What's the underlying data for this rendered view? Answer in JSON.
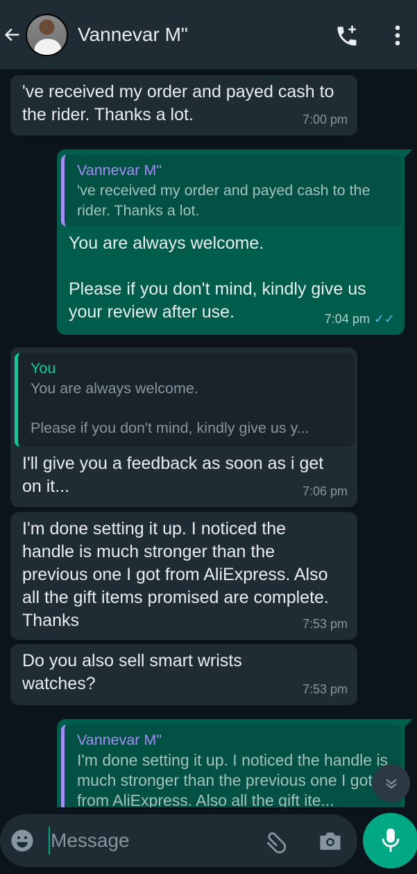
{
  "header": {
    "title": "Vannevar M\"",
    "back_icon": "arrow-left-icon",
    "call_icon": "phone-plus-icon",
    "menu_icon": "more-vertical-icon"
  },
  "messages": [
    {
      "dir": "in",
      "text": "'ve received my order and payed cash to the rider. Thanks a lot.",
      "time": "7:00 pm"
    },
    {
      "dir": "out",
      "quote": {
        "name": "Vannevar M\"",
        "text": "'ve received my order and payed cash to the rider. Thanks a lot."
      },
      "text1": "You are always welcome.",
      "text2": "Please if you don't mind, kindly give us your review after use.",
      "time": "7:04 pm",
      "status": "read"
    },
    {
      "dir": "in",
      "quote": {
        "name": "You",
        "text1": "You are always welcome.",
        "text2": "Please if you don't mind, kindly give us y..."
      },
      "text": "I'll give you a feedback as soon as i get on it...",
      "time": "7:06 pm"
    },
    {
      "dir": "in",
      "text": "I'm done setting it up. I noticed the handle is much stronger than the previous one I got from AliExpress. Also all the gift items promised are complete. Thanks",
      "time": "7:53 pm"
    },
    {
      "dir": "in",
      "text": "Do you also sell smart wrists watches?",
      "time": "7:53 pm"
    },
    {
      "dir": "out",
      "quote": {
        "name": "Vannevar M\"",
        "text": "I'm done setting it up. I noticed the handle is much stronger than the previous one I got from AliExpress. Also all the gift ite..."
      }
    }
  ],
  "composer": {
    "placeholder": "Message",
    "emoji_icon": "emoji-icon",
    "attach_icon": "paperclip-icon",
    "camera_icon": "camera-icon",
    "mic_icon": "mic-icon"
  },
  "colors": {
    "header": "#1f2c34",
    "background": "#0b141a",
    "incoming": "#202c33",
    "outgoing": "#005c4b",
    "accent": "#00a884",
    "read_ticks": "#53bdeb"
  }
}
